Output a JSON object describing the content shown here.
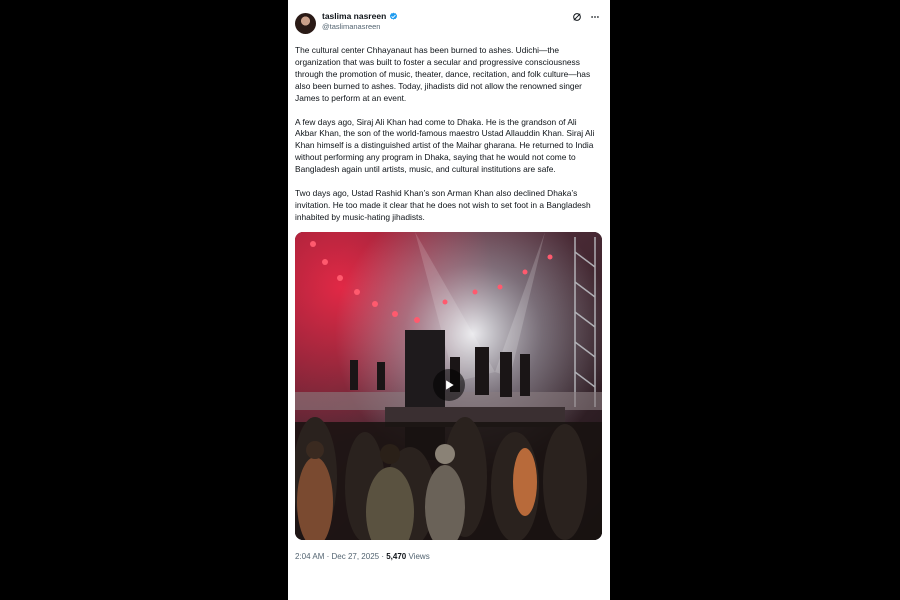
{
  "post": {
    "author_name": "taslima nasreen",
    "author_handle": "@taslimanasreen",
    "paragraphs": [
      "The cultural center Chhayanaut has been burned to ashes. Udichi—the organization that was built to foster a secular and progressive consciousness through the promotion of music, theater, dance, recitation, and folk culture—has also been burned to ashes. Today, jihadists did not allow the renowned singer James to perform at an event.",
      "A few days ago, Siraj Ali Khan had come to Dhaka. He is the grandson of Ali Akbar Khan, the son of the world-famous maestro Ustad Allauddin Khan. Siraj Ali Khan himself is a distinguished artist of the Maihar gharana. He returned to India without performing any program in Dhaka, saying that he would not come to Bangladesh again until artists, music, and cultural institutions are safe.",
      "Two days ago, Ustad Rashid Khan’s son Arman Khan also declined Dhaka’s invitation. He too made it clear that he does not wish to set foot in a Bangladesh inhabited by music-hating jihadists."
    ],
    "time": "2:04 AM",
    "separator": "·",
    "date": "Dec 27, 2025",
    "views_count": "5,470",
    "views_label": "Views"
  },
  "icons": {
    "verified": "verified-badge-icon",
    "grok": "grok-icon",
    "more": "more-icon",
    "play": "play-icon"
  },
  "colors": {
    "verified": "#1d9bf0",
    "secondary_text": "#536471",
    "primary_text": "#0f1419"
  }
}
